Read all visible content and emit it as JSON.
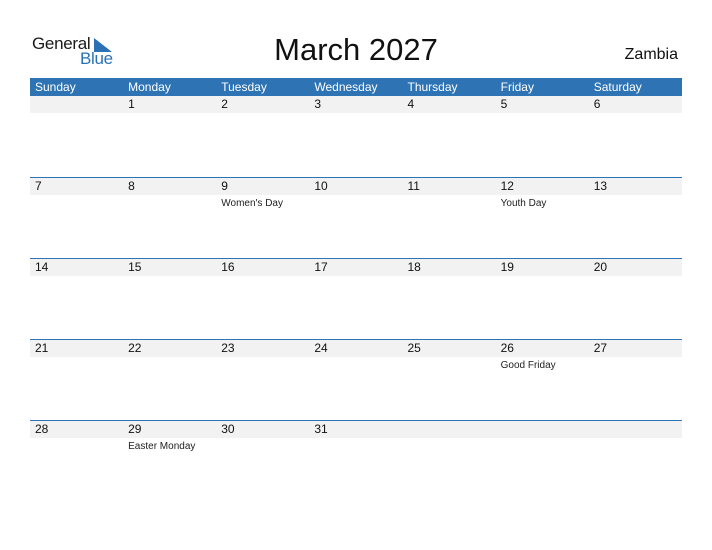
{
  "logo": {
    "text_general": "General",
    "text_blue": "Blue",
    "icon": "triangle-flag-icon"
  },
  "header": {
    "title": "March 2027",
    "country": "Zambia"
  },
  "colors": {
    "accent": "#2e74b5",
    "date_strip": "#f2f2f2",
    "logo_blue": "#2a72b5"
  },
  "weekdays": [
    "Sunday",
    "Monday",
    "Tuesday",
    "Wednesday",
    "Thursday",
    "Friday",
    "Saturday"
  ],
  "weeks": [
    {
      "days": [
        {
          "date": ""
        },
        {
          "date": "1"
        },
        {
          "date": "2"
        },
        {
          "date": "3"
        },
        {
          "date": "4"
        },
        {
          "date": "5"
        },
        {
          "date": "6"
        }
      ]
    },
    {
      "days": [
        {
          "date": "7"
        },
        {
          "date": "8"
        },
        {
          "date": "9",
          "holiday": "Women's Day"
        },
        {
          "date": "10"
        },
        {
          "date": "11"
        },
        {
          "date": "12",
          "holiday": "Youth Day"
        },
        {
          "date": "13"
        }
      ]
    },
    {
      "days": [
        {
          "date": "14"
        },
        {
          "date": "15"
        },
        {
          "date": "16"
        },
        {
          "date": "17"
        },
        {
          "date": "18"
        },
        {
          "date": "19"
        },
        {
          "date": "20"
        }
      ]
    },
    {
      "days": [
        {
          "date": "21"
        },
        {
          "date": "22"
        },
        {
          "date": "23"
        },
        {
          "date": "24"
        },
        {
          "date": "25"
        },
        {
          "date": "26",
          "holiday": "Good Friday"
        },
        {
          "date": "27"
        }
      ]
    },
    {
      "days": [
        {
          "date": "28"
        },
        {
          "date": "29",
          "holiday": "Easter Monday"
        },
        {
          "date": "30"
        },
        {
          "date": "31"
        },
        {
          "date": ""
        },
        {
          "date": ""
        },
        {
          "date": ""
        }
      ]
    }
  ]
}
